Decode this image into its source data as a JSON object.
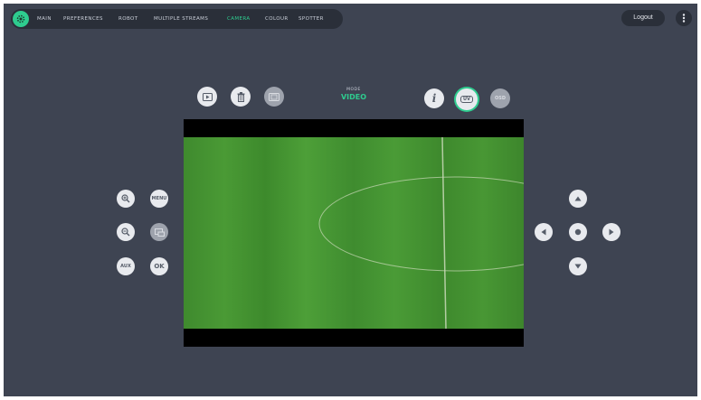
{
  "nav": {
    "items": [
      {
        "label": "MAIN",
        "active": false
      },
      {
        "label": "PREFERENCES",
        "active": false
      },
      {
        "label": "ROBOT",
        "active": false
      },
      {
        "label": "MULTIPLE STREAMS",
        "active": false
      },
      {
        "label": "CAMERA",
        "active": true
      },
      {
        "label": "COLOUR",
        "active": false
      },
      {
        "label": "SPOTTER",
        "active": false
      }
    ],
    "logout_label": "Logout"
  },
  "toolbar": {
    "icons": [
      "play-icon",
      "trash-icon",
      "film-icon"
    ],
    "mode_label": "MODE",
    "mode_value": "VIDEO",
    "info_label": "i",
    "uv_label": "UV",
    "osd_label": "OSD"
  },
  "left_controls": {
    "menu_label": "MENU",
    "aux_label": "AUX",
    "ok_label": "OK"
  },
  "colors": {
    "accent": "#2ecc8f",
    "background": "#3e4452",
    "nav_background": "#2a2f39"
  }
}
